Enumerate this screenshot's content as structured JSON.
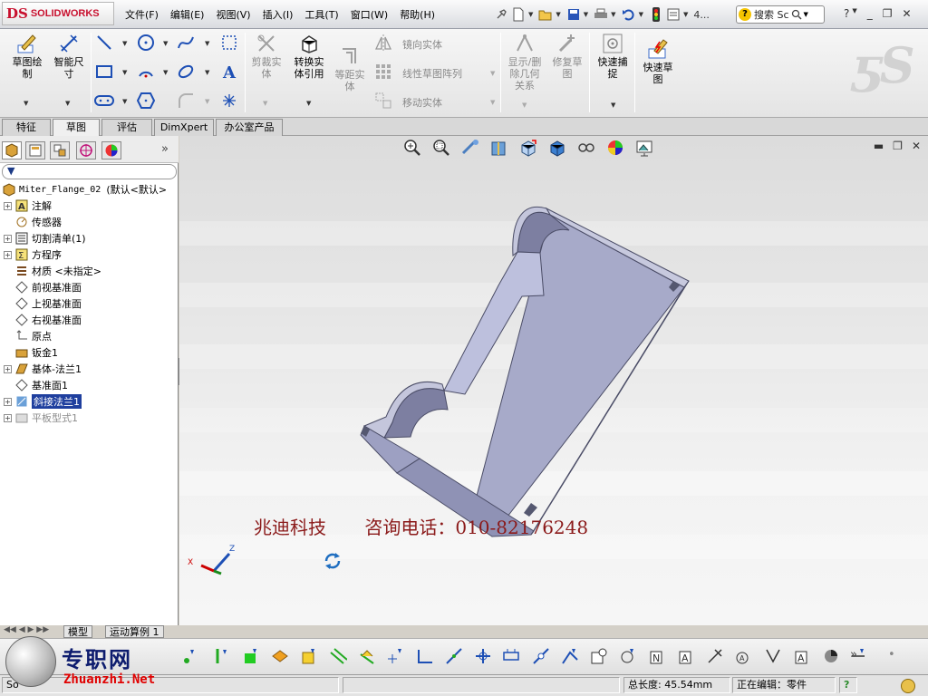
{
  "app": {
    "logo_mark": "DS",
    "logo_text": "SOLIDWORKS"
  },
  "menus": [
    "文件(F)",
    "编辑(E)",
    "视图(V)",
    "插入(I)",
    "工具(T)",
    "窗口(W)",
    "帮助(H)"
  ],
  "quick_access": {
    "overflow": "4..."
  },
  "search": {
    "placeholder": "搜索 Sc"
  },
  "ribbon": {
    "sketch": "草图绘\n制",
    "smart_dim": "智能尺\n寸",
    "trim": "剪裁实\n体",
    "convert": "转换实\n体引用",
    "offset": "等距实\n体",
    "mirror": "镜向实体",
    "linear_pattern": "线性草图阵列",
    "move": "移动实体",
    "show_delete": "显示/删\n除几何\n关系",
    "repair": "修复草\n图",
    "quick_snap": "快速捕\n捉",
    "rapid_sketch": "快速草\n图"
  },
  "tabs": [
    "特征",
    "草图",
    "评估",
    "DimXpert",
    "办公室产品"
  ],
  "active_tab": "草图",
  "tree": {
    "root_name": "Miter_Flange_02",
    "root_config": "(默认<默认>",
    "items": [
      {
        "label": "注解",
        "icon": "annotations-icon",
        "expandable": true
      },
      {
        "label": "传感器",
        "icon": "sensors-icon",
        "expandable": false
      },
      {
        "label": "切割清单(1)",
        "icon": "cut-list-icon",
        "expandable": true
      },
      {
        "label": "方程序",
        "icon": "equations-icon",
        "expandable": true
      },
      {
        "label": "材质 <未指定>",
        "icon": "material-icon",
        "expandable": false
      },
      {
        "label": "前视基准面",
        "icon": "plane-icon",
        "expandable": false
      },
      {
        "label": "上视基准面",
        "icon": "plane-icon",
        "expandable": false
      },
      {
        "label": "右视基准面",
        "icon": "plane-icon",
        "expandable": false
      },
      {
        "label": "原点",
        "icon": "origin-icon",
        "expandable": false
      },
      {
        "label": "钣金1",
        "icon": "sheet-metal-icon",
        "expandable": false
      },
      {
        "label": "基体-法兰1",
        "icon": "base-flange-icon",
        "expandable": true
      },
      {
        "label": "基准面1",
        "icon": "plane-icon",
        "expandable": false
      },
      {
        "label": "斜接法兰1",
        "icon": "miter-flange-icon",
        "expandable": true,
        "selected": true
      },
      {
        "label": "平板型式1",
        "icon": "flat-pattern-icon",
        "expandable": true,
        "dimmed": true
      }
    ]
  },
  "viewport": {
    "watermark_company": "兆迪科技",
    "watermark_phone": "咨询电话：010-82176248",
    "model_color": "#a7aac9"
  },
  "bottom_tabs": [
    "模型",
    "运动算例 1"
  ],
  "status": {
    "left": "So",
    "length_label": "总长度: 45.54mm",
    "editing": "正在编辑：零件",
    "help_icon": "?"
  },
  "site_logo": {
    "cn": "专职网",
    "en": "Zhuanzhi.Net"
  }
}
